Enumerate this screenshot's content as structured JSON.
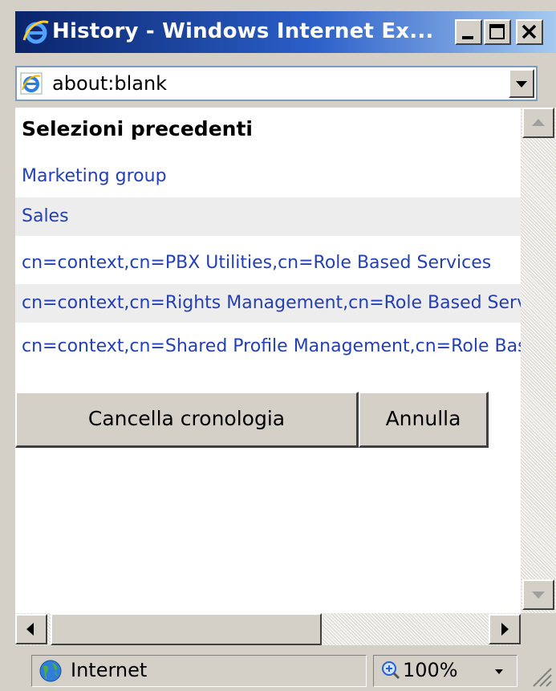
{
  "window": {
    "title": "History - Windows Internet Ex...",
    "icon": "ie-icon",
    "controls": [
      "minimize-icon",
      "maximize-icon",
      "close-icon"
    ]
  },
  "address": {
    "url": "about:blank",
    "icon": "ie-page-icon"
  },
  "content": {
    "heading": "Selezioni precedenti",
    "items": [
      {
        "label": "Marketing group"
      },
      {
        "label": "Sales"
      },
      {
        "label": "cn=context,cn=PBX Utilities,cn=Role Based Services"
      },
      {
        "label": "cn=context,cn=Rights Management,cn=Role Based Services"
      },
      {
        "label": "cn=context,cn=Shared Profile Management,cn=Role Based Services"
      }
    ],
    "buttons": {
      "clear_history": "Cancella cronologia",
      "cancel": "Annulla"
    }
  },
  "statusbar": {
    "zone": "Internet",
    "zoom": "100%"
  },
  "colors": {
    "title_gradient_start": "#0a246a",
    "link": "#2440b3",
    "alt_row": "#ededed",
    "chrome": "#d4d0c8"
  }
}
